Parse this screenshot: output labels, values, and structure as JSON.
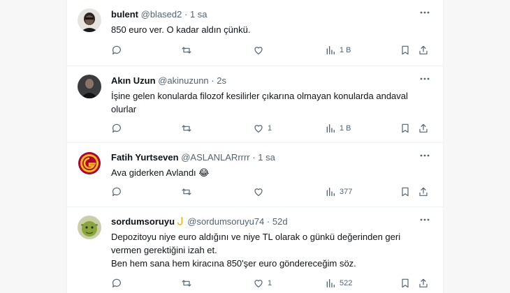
{
  "tweets": [
    {
      "avatar": "bulent-avatar",
      "name": "bulent",
      "handle": "@blased2",
      "dot": "·",
      "time": "1 sa",
      "lines": [
        "850 euro ver. O kadar aldın çünkü."
      ],
      "replies": "",
      "retweets": "",
      "likes": "",
      "views": "1 B"
    },
    {
      "avatar": "akin-uzun-avatar",
      "name": "Akın Uzun",
      "handle": "@akinuzunn",
      "dot": "·",
      "time": "2s",
      "lines": [
        "İşine gelen konularda filozof kesilirler çıkarına olmayan konularda andaval",
        "olurlar"
      ],
      "replies": "",
      "retweets": "",
      "likes": "1",
      "views": "1 B"
    },
    {
      "avatar": "galatasaray-logo-avatar",
      "name": "Fatih Yurtseven",
      "handle": "@ASLANLARrrrr",
      "dot": "·",
      "time": "1 sa",
      "lines": [
        "Ava giderken Avlandı 😂"
      ],
      "replies": "",
      "retweets": "",
      "likes": "",
      "views": "377"
    },
    {
      "avatar": "shrek-avatar",
      "name": "sordumsoruyu",
      "name_emoji": "hook-icon",
      "handle": "@sordumsoruyu74",
      "dot": "·",
      "time": "52d",
      "lines": [
        "Depozitoyu niye euro aldığını ve niye TL olarak o günkü değerinden geri",
        "vermen gerektiğini izah et.",
        "Ben hem sana hem kiracına 850'şer euro göndereceğim söz."
      ],
      "replies": "",
      "retweets": "",
      "likes": "1",
      "views": "522"
    }
  ],
  "colors": {
    "text": "#0f1419",
    "muted": "#536471",
    "border": "#eff3f4",
    "hook": "#f4b400"
  }
}
